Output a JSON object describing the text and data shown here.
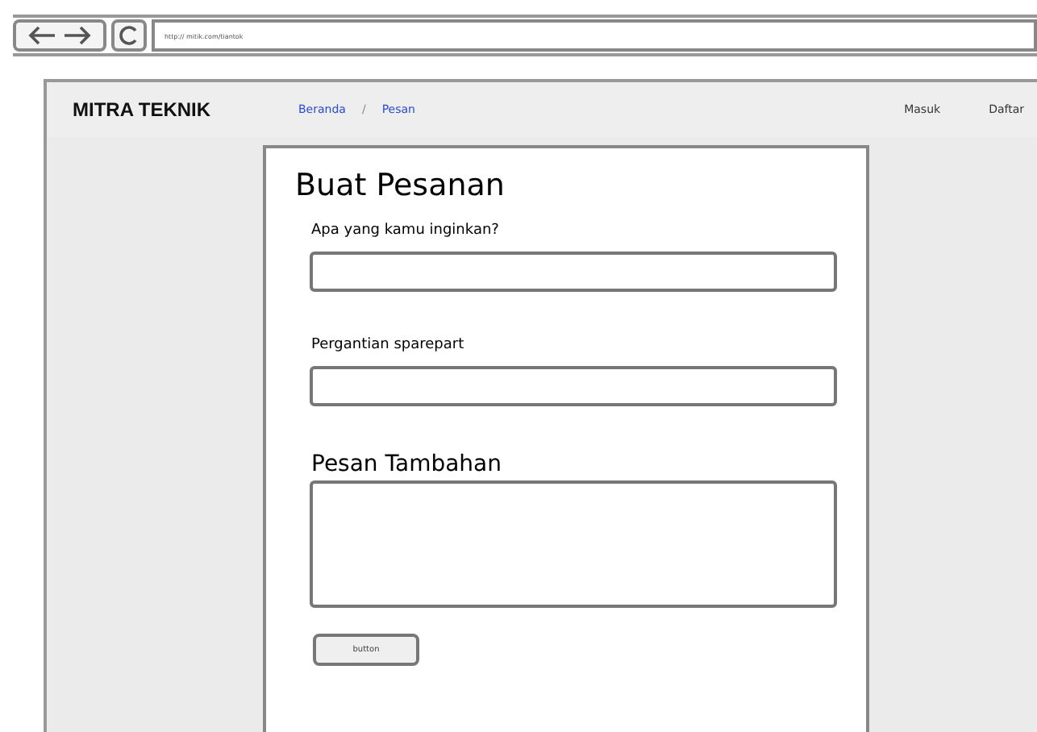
{
  "browser": {
    "url": "http:// mitik.com/tiantok"
  },
  "header": {
    "logo": "MITRA TEKNIK",
    "nav": [
      {
        "label": "Beranda"
      },
      {
        "label": "Pesan"
      }
    ],
    "separator": "/",
    "actions": [
      {
        "label": "Masuk"
      },
      {
        "label": "Daftar"
      }
    ]
  },
  "form": {
    "title": "Buat Pesanan",
    "fields": [
      {
        "kind": "input",
        "label": "Apa yang kamu inginkan?"
      },
      {
        "kind": "input",
        "label": "Pergantian sparepart"
      },
      {
        "kind": "textarea",
        "label": "Pesan Tambahan"
      }
    ],
    "button": "button"
  }
}
